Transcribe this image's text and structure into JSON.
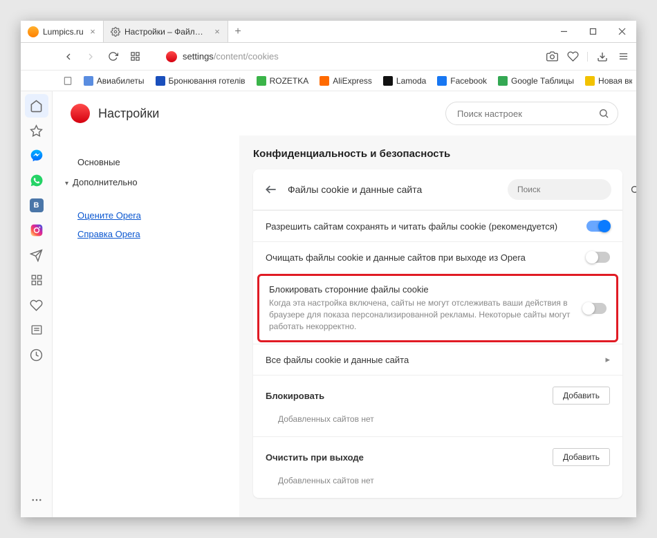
{
  "tabs": [
    {
      "title": "Lumpics.ru",
      "active": false
    },
    {
      "title": "Настройки – Файлы cookie",
      "active": true
    }
  ],
  "url": {
    "prefix": "settings",
    "rest": "/content/cookies"
  },
  "bookmarks": [
    {
      "label": "Авиабилеты",
      "color": "#5a8de0"
    },
    {
      "label": "Бронювання готелів",
      "color": "#1a4fbc"
    },
    {
      "label": "ROZETKA",
      "color": "#3bb449"
    },
    {
      "label": "AliExpress",
      "color": "#ff6a00"
    },
    {
      "label": "Lamoda",
      "color": "#111"
    },
    {
      "label": "Facebook",
      "color": "#1877f2"
    },
    {
      "label": "Google Таблицы",
      "color": "#34a853"
    },
    {
      "label": "Новая вкладка",
      "color": "#f2c200"
    }
  ],
  "page": {
    "title": "Настройки",
    "search_placeholder": "Поиск настроек"
  },
  "nav": {
    "basic": "Основные",
    "advanced": "Дополнительно",
    "rate": "Оцените Opera",
    "help": "Справка Opera"
  },
  "main": {
    "section": "Конфиденциальность и безопасность",
    "card_title": "Файлы cookie и данные сайта",
    "mini_search": "Поиск",
    "row_allow": "Разрешить сайтам сохранять и читать файлы cookie (рекомендуется)",
    "row_clear": "Очищать файлы cookie и данные сайтов при выходе из Opera",
    "row_block3p_title": "Блокировать сторонние файлы cookie",
    "row_block3p_desc": "Когда эта настройка включена, сайты не могут отслеживать ваши действия в браузере для показа персонализированной рекламы. Некоторые сайты могут работать некорректно.",
    "row_all": "Все файлы cookie и данные сайта",
    "block_header": "Блокировать",
    "add_btn": "Добавить",
    "empty": "Добавленных сайтов нет",
    "clear_exit_header": "Очистить при выходе"
  }
}
